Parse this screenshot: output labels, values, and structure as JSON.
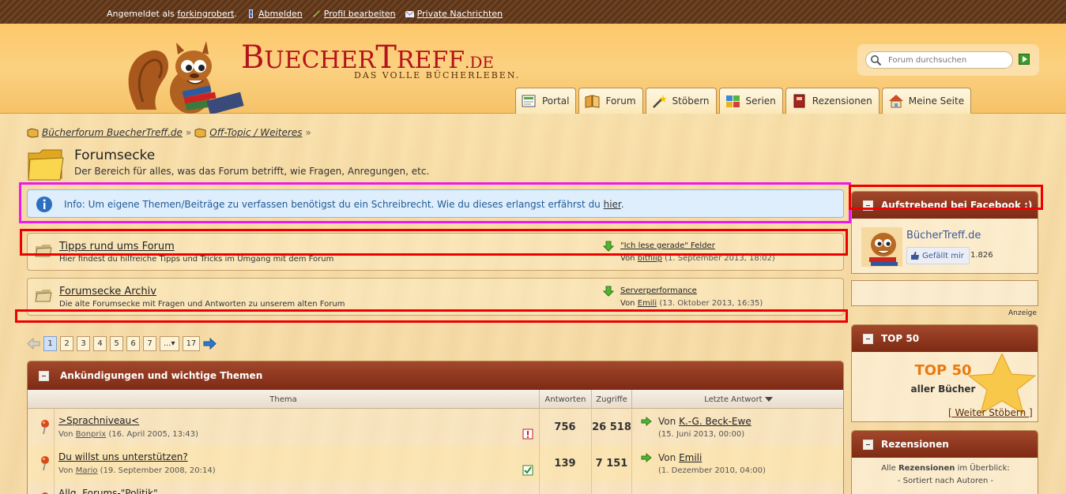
{
  "topbar": {
    "logged_in_label": "Angemeldet als",
    "username": "forkingrobert",
    "dot": ".",
    "logout": "Abmelden",
    "edit_profile": "Profil bearbeiten",
    "private_messages": "Private Nachrichten"
  },
  "header": {
    "logo_big1": "B",
    "logo_small1": "UECHER",
    "logo_big2": "T",
    "logo_small2": "REFF",
    "logo_de": ".DE",
    "slogan": "DAS VOLLE BÜCHERLEBEN.",
    "search_placeholder": "Forum durchsuchen"
  },
  "nav": {
    "tabs": [
      {
        "label": "Portal",
        "icon": "portal-icon"
      },
      {
        "label": "Forum",
        "icon": "book-icon"
      },
      {
        "label": "Stöbern",
        "icon": "magic-wand-icon"
      },
      {
        "label": "Serien",
        "icon": "puzzle-icon"
      },
      {
        "label": "Rezensionen",
        "icon": "red-book-icon"
      },
      {
        "label": "Meine Seite",
        "icon": "home-icon"
      }
    ]
  },
  "breadcrumb": {
    "items": [
      "Bücherforum BuecherTreff.de",
      "Off-Topic / Weiteres"
    ],
    "sep": "»"
  },
  "page": {
    "title": "Forumsecke",
    "description": "Der Bereich für alles, was das Forum betrifft, wie Fragen, Anregungen, etc."
  },
  "info": {
    "text": "Info: Um eigene Themen/Beiträge zu verfassen benötigst du ein Schreibrecht. Wie du dieses erlangst erfährst du ",
    "link": "hier",
    "end": "."
  },
  "subforums": [
    {
      "title": "Tipps rund ums Forum",
      "description": "Hier findest du hilfreiche Tipps und Tricks im Umgang mit dem Forum",
      "last_title": "\"Ich lese gerade\" Felder",
      "by_label": "Von",
      "last_user": "bitfilip",
      "last_date": "(1. September 2013, 18:02)"
    },
    {
      "title": "Forumsecke Archiv",
      "description": "Die alte Forumsecke mit Fragen und Antworten zu unserem alten Forum",
      "last_title": "Serverperformance",
      "by_label": "Von",
      "last_user": "Emili",
      "last_date": "(13. Oktober 2013, 16:35)"
    }
  ],
  "pagination": {
    "pages": [
      "1",
      "2",
      "3",
      "4",
      "5",
      "6",
      "7",
      "...▾",
      "17"
    ],
    "current": "1"
  },
  "topics_section": {
    "title": "Ankündigungen und wichtige Themen",
    "columns": {
      "topic": "Thema",
      "replies": "Antworten",
      "views": "Zugriffe",
      "last": "Letzte Antwort"
    },
    "rows": [
      {
        "title": ">Sprachniveau<",
        "by_label": "Von",
        "author": "Bonprix",
        "date": "(16. April 2005, 13:43)",
        "status_icon": "important-icon",
        "replies": "756",
        "views": "26 518",
        "last_by_label": "Von",
        "last_user": "K.-G. Beck-Ewe",
        "last_date": "(15. Juni 2013, 00:00)"
      },
      {
        "title": "Du willst uns unterstützen?",
        "by_label": "Von",
        "author": "Mario",
        "date": "(19. September 2008, 20:14)",
        "status_icon": "checked-icon",
        "replies": "139",
        "views": "7 151",
        "last_by_label": "Von",
        "last_user": "Emili",
        "last_date": "(1. Dezember 2010, 04:00)"
      },
      {
        "title": "Allg. Forums-\"Politik\"",
        "by_label": "",
        "author": "",
        "date": "",
        "status_icon": "",
        "replies": "",
        "views": "",
        "last_by_label": "",
        "last_user": "",
        "last_date": ""
      }
    ]
  },
  "sidebar": {
    "facebook": {
      "title": "Aufstrebend bei Facebook :)",
      "page_name": "BücherTreff.de",
      "like_label": "Gefällt mir",
      "like_count": "1.826"
    },
    "ad_label": "Anzeige",
    "top50": {
      "title": "TOP 50",
      "big": "TOP 50",
      "sub": "aller Bücher",
      "link": "[ Weiter Stöbern ]"
    },
    "reviews": {
      "title": "Rezensionen",
      "line1_a": "Alle",
      "line1_b": "Rezensionen",
      "line1_c": "im Überblick:",
      "line2": "- Sortiert nach Autoren -"
    }
  },
  "colors": {
    "header_brown": "#7e2a14",
    "logo_red": "#b4121c",
    "info_blue": "#1f5a96",
    "highlight_red": "#ee0000",
    "highlight_magenta": "#ee18ee"
  }
}
